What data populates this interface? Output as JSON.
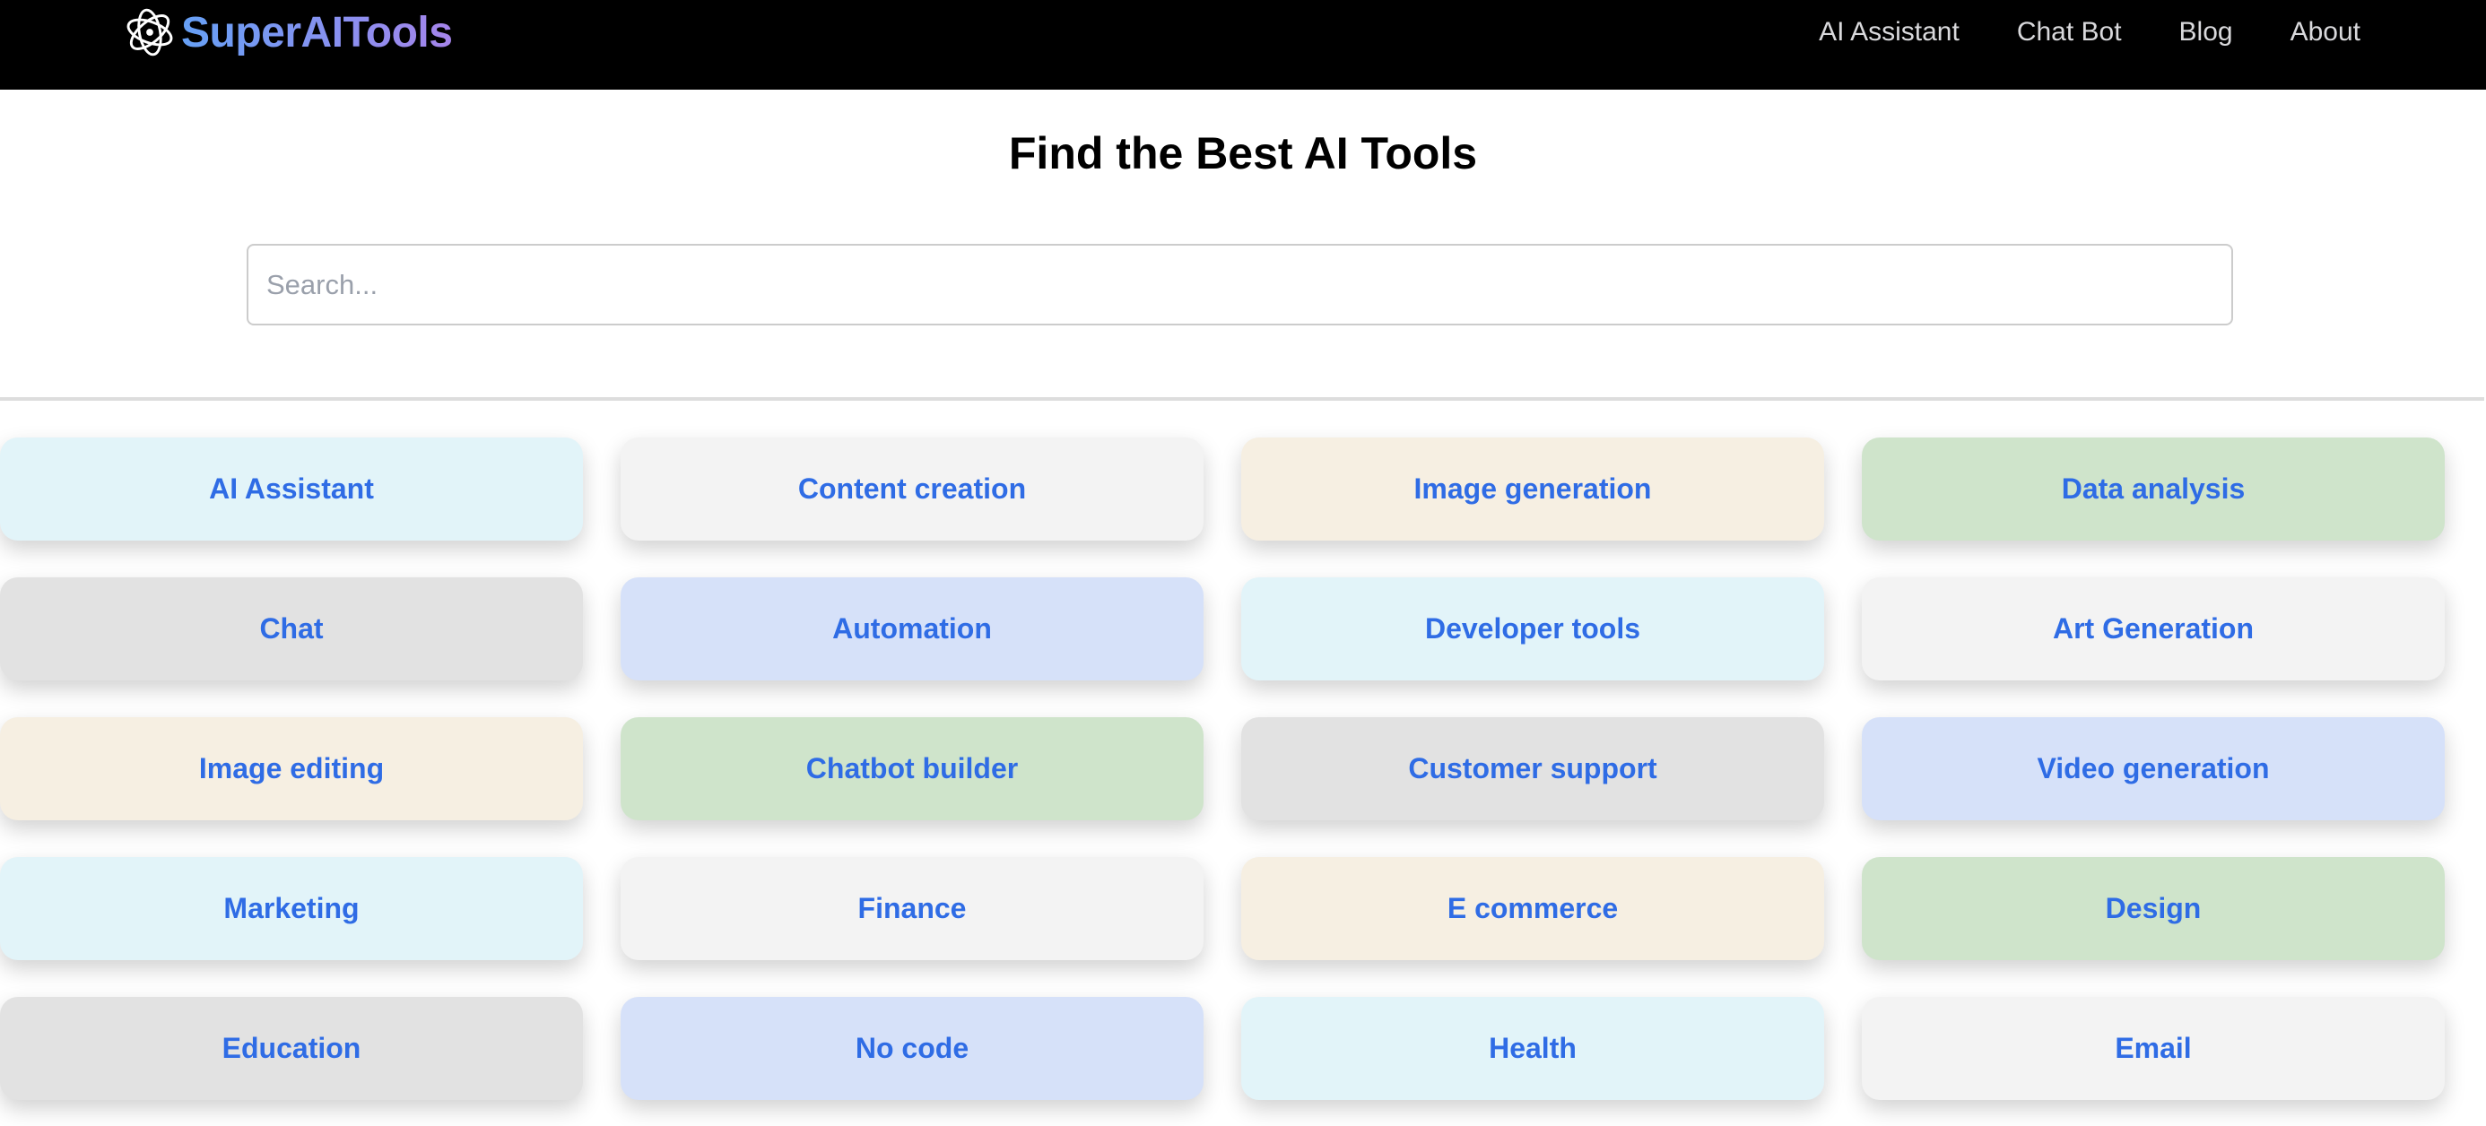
{
  "header": {
    "brand": "SuperAITools",
    "logo_icon": "flower-swirl-logo-icon",
    "nav": [
      {
        "label": "AI Assistant"
      },
      {
        "label": "Chat Bot"
      },
      {
        "label": "Blog"
      },
      {
        "label": "About"
      }
    ]
  },
  "hero": {
    "title": "Find the Best AI Tools",
    "search_placeholder": "Search...",
    "search_value": ""
  },
  "theme": {
    "accent": "#2f6ce5",
    "navbar_bg": "#000000",
    "card_colors": {
      "cyan": "#e2f4f9",
      "light_gray": "#f3f3f3",
      "cream": "#f6efe2",
      "green": "#cfe4cb",
      "gray": "#e2e2e2",
      "blue": "#d6e1f9"
    }
  },
  "categories": [
    {
      "label": "AI Assistant",
      "color": "#e2f4f9"
    },
    {
      "label": "Content creation",
      "color": "#f3f3f3"
    },
    {
      "label": "Image generation",
      "color": "#f6efe2"
    },
    {
      "label": "Data analysis",
      "color": "#cfe4cb"
    },
    {
      "label": "Chat",
      "color": "#e2e2e2"
    },
    {
      "label": "Automation",
      "color": "#d6e1f9"
    },
    {
      "label": "Developer tools",
      "color": "#e2f4f9"
    },
    {
      "label": "Art Generation",
      "color": "#f3f3f3"
    },
    {
      "label": "Image editing",
      "color": "#f6efe2"
    },
    {
      "label": "Chatbot builder",
      "color": "#cfe4cb"
    },
    {
      "label": "Customer support",
      "color": "#e2e2e2"
    },
    {
      "label": "Video generation",
      "color": "#d6e1f9"
    },
    {
      "label": "Marketing",
      "color": "#e2f4f9"
    },
    {
      "label": "Finance",
      "color": "#f3f3f3"
    },
    {
      "label": "E commerce",
      "color": "#f6efe2"
    },
    {
      "label": "Design",
      "color": "#cfe4cb"
    },
    {
      "label": "Education",
      "color": "#e2e2e2"
    },
    {
      "label": "No code",
      "color": "#d6e1f9"
    },
    {
      "label": "Health",
      "color": "#e2f4f9"
    },
    {
      "label": "Email",
      "color": "#f3f3f3"
    }
  ]
}
